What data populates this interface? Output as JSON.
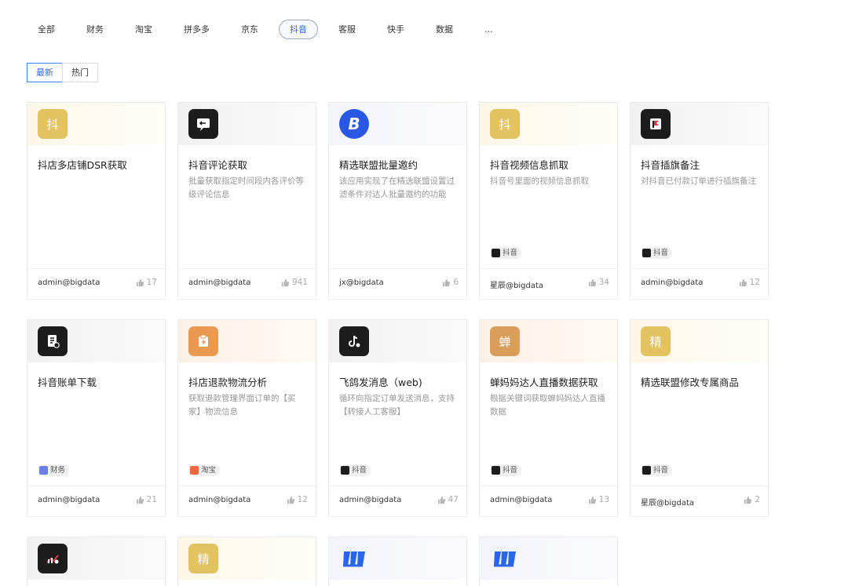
{
  "categories": [
    "全部",
    "财务",
    "淘宝",
    "拼多多",
    "京东",
    "抖音",
    "客服",
    "快手",
    "数据",
    "..."
  ],
  "active_category": "抖音",
  "sort": [
    "最新",
    "热门"
  ],
  "active_sort": "最新",
  "colors": {
    "accent": "#2f6bde",
    "tag_bg": "#f0f0f0"
  },
  "cards": [
    {
      "icon_text": "抖",
      "icon": "dou-char-icon",
      "title": "抖店多店铺DSR获取",
      "desc": "",
      "tag": "",
      "author": "admin@bigdata",
      "likes": "17"
    },
    {
      "icon_text": "",
      "icon": "comment-bubble-icon",
      "title": "抖音评论获取",
      "desc": "批量获取指定时间段内各评价等级评论信息",
      "tag": "",
      "author": "admin@bigdata",
      "likes": "941"
    },
    {
      "icon_text": "B",
      "icon": "letter-b-icon",
      "title": "精选联盟批量邀约",
      "desc": "该应用实现了在精选联盟设置过滤条件对达人批量邀约的功能",
      "tag": "",
      "author": "jx@bigdata",
      "likes": "6"
    },
    {
      "icon_text": "抖",
      "icon": "dou-char-icon",
      "title": "抖音视频信息抓取",
      "desc": "抖音号里面的视频信息抓取",
      "tag": "抖音",
      "author": "星辰@bigdata",
      "likes": "34"
    },
    {
      "icon_text": "",
      "icon": "flag-icon",
      "title": "抖音插旗备注",
      "desc": "对抖音已付款订单进行插旗备注",
      "tag": "抖音",
      "author": "admin@bigdata",
      "likes": "12"
    },
    {
      "icon_text": "",
      "icon": "bill-document-icon",
      "title": "抖音账单下载",
      "desc": "",
      "tag": "财务",
      "author": "admin@bigdata",
      "likes": "21"
    },
    {
      "icon_text": "",
      "icon": "refund-clipboard-icon",
      "title": "抖店退款物流分析",
      "desc": "获取退款管理界面订单的【买家】物流信息",
      "tag": "淘宝",
      "author": "admin@bigdata",
      "likes": "12"
    },
    {
      "icon_text": "",
      "icon": "tiktok-chat-icon",
      "title": "飞鸽发消息（web)",
      "desc": "循环向指定订单发送消息，支持【转接人工客服】",
      "tag": "抖音",
      "author": "admin@bigdata",
      "likes": "47"
    },
    {
      "icon_text": "蝉",
      "icon": "chan-char-icon",
      "title": "蝉妈妈达人直播数据获取",
      "desc": "根据关键词获取蝉妈妈达人直播数据",
      "tag": "抖音",
      "author": "admin@bigdata",
      "likes": "13"
    },
    {
      "icon_text": "精",
      "icon": "jing-char-icon",
      "title": "精选联盟修改专属商品",
      "desc": "",
      "tag": "抖音",
      "author": "星辰@bigdata",
      "likes": "2"
    }
  ],
  "partial_cards": [
    {
      "icon_text": "",
      "icon": "chart-app-icon"
    },
    {
      "icon_text": "精",
      "icon": "jing-char-icon"
    },
    {
      "icon_text": "",
      "icon": "brand-logo-icon"
    },
    {
      "icon_text": "",
      "icon": "brand-logo-icon"
    }
  ]
}
